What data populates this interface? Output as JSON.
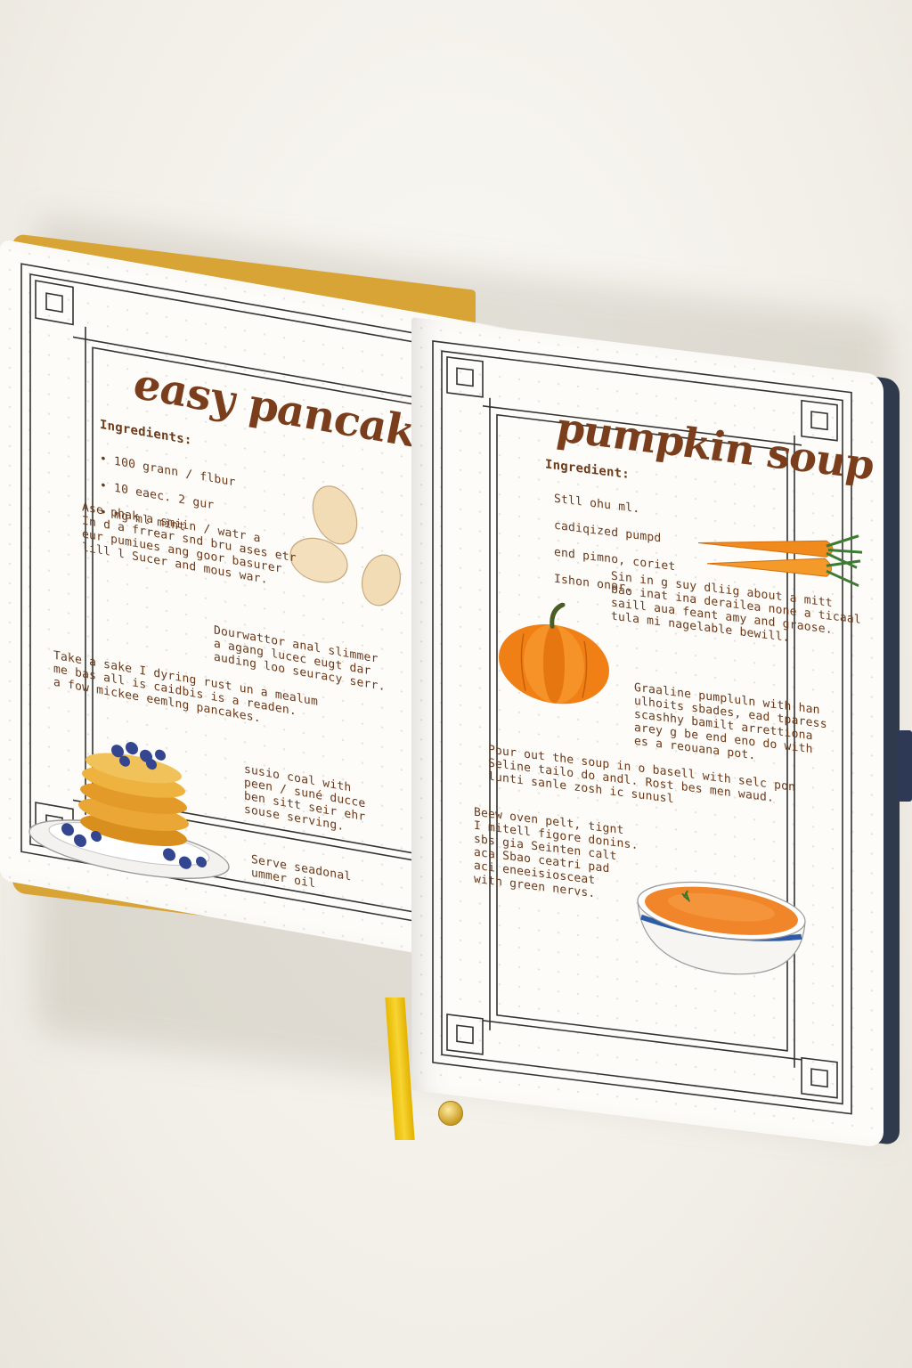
{
  "left_page": {
    "title": "easy pancakes",
    "ingredients_heading": "Ingredients:",
    "ingredients": [
      "• 100 grann / flbur",
      "• 10 eaec. 2 gur",
      "• mg ml mint"
    ],
    "para1": "Ase phak a smiin / watr a\nIn d a frrear snd bru ases etr\neur pumiues ang goor basurer\nlill l Sucer and mous war.",
    "para2": "Dourwattor anal slimmer\na agang lucec eugt dar\nauding loo seuracy serr.",
    "para3": "Take a sake I dyring rust un a mealum\nme bas all is caidbis is a readen.\na fow mickee eemlng pancakes.",
    "para4": "susio coal with\npeen / suné ducce\nben sitt seir ehr\nsouse serving.",
    "para5": "Serve seadonal\nummer oil",
    "illustrations": [
      "potato-illustration",
      "pancake-stack-illustration"
    ]
  },
  "right_page": {
    "title": "pumpkin soup",
    "ingredients_heading": "Ingredient:",
    "ingredients": [
      "Stll ohu ml.",
      "cadiqized pumpd",
      "end pimno, coriet",
      "Ishon onar."
    ],
    "para1": "Sin in g suy dliig about a mitt\nbao inat ina derailea none a ticaal\nsaill aua feant amy and graose.\ntula mi nagelable bewill.",
    "para2": "Graaline pumpluln with han\nulhoits sbades, ead tparess\nscashhy bamilt arrettiona\narey g be end eno do with\nes a reouana pot.",
    "para3": "Pour out the soup in o basell with selc pon\nSeline tailo do andl. Rost bes men waud.\nlunti sanle zosh ic sunusl",
    "para4": "Beew oven pelt, tignt\nI mitell figore donins.\nsbs gia Seinten calt\naca Sbao ceatri pad\naci eneeisiosceat\nwith green nervs.",
    "illustrations": [
      "carrot-illustration",
      "pumpkin-illustration",
      "soup-bowl-illustration"
    ]
  },
  "colors": {
    "ink": "#6a3a1c",
    "title_ink": "#7b3e1d",
    "cover_left": "#d8a436",
    "cover_right": "#2f3a4c",
    "ribbon": "#f2c81a"
  }
}
